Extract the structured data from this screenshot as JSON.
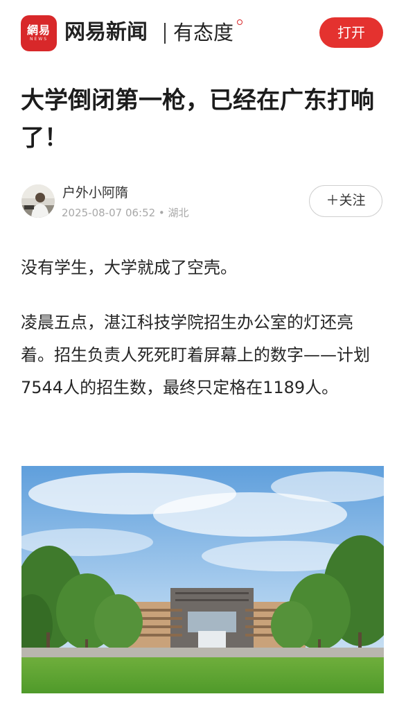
{
  "header": {
    "logo_main": "網易",
    "logo_sub": "NEWS",
    "brand": "网易新闻",
    "slogan": "有态度",
    "open_button": "打开",
    "brand_color": "#d8282a"
  },
  "article": {
    "title": "大学倒闭第一枪，已经在广东打响了！",
    "author": {
      "name": "户外小阿隋",
      "meta": "2025-08-07 06:52 • 湖北",
      "follow_label": "＋关注"
    },
    "paragraphs": [
      "没有学生，大学就成了空壳。",
      "凌晨五点，湛江科技学院招生办公室的灯还亮着。招生负责人死死盯着屏幕上的数字——计划7544人的招生数，最终只定格在1189人。"
    ]
  },
  "icons": {
    "logo": "netease-news-logo-icon"
  }
}
